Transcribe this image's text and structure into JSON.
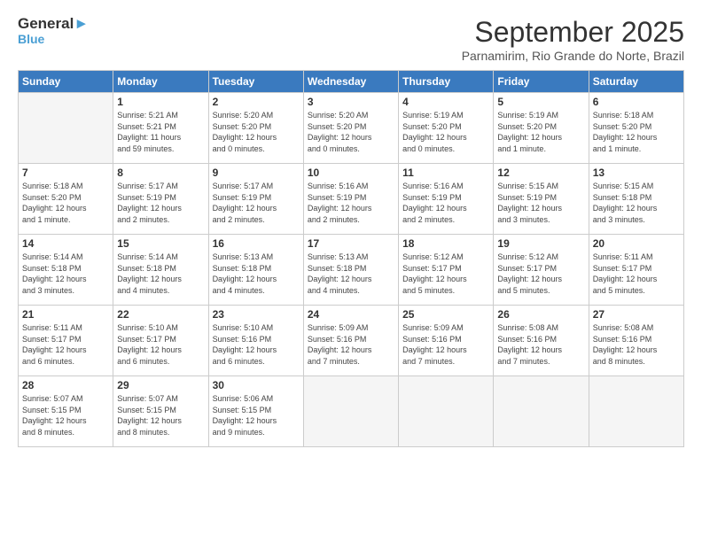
{
  "header": {
    "logo_line1": "General",
    "logo_line2": "Blue",
    "month_title": "September 2025",
    "subtitle": "Parnamirim, Rio Grande do Norte, Brazil"
  },
  "days_of_week": [
    "Sunday",
    "Monday",
    "Tuesday",
    "Wednesday",
    "Thursday",
    "Friday",
    "Saturday"
  ],
  "weeks": [
    [
      {
        "num": "",
        "info": ""
      },
      {
        "num": "1",
        "info": "Sunrise: 5:21 AM\nSunset: 5:21 PM\nDaylight: 11 hours\nand 59 minutes."
      },
      {
        "num": "2",
        "info": "Sunrise: 5:20 AM\nSunset: 5:20 PM\nDaylight: 12 hours\nand 0 minutes."
      },
      {
        "num": "3",
        "info": "Sunrise: 5:20 AM\nSunset: 5:20 PM\nDaylight: 12 hours\nand 0 minutes."
      },
      {
        "num": "4",
        "info": "Sunrise: 5:19 AM\nSunset: 5:20 PM\nDaylight: 12 hours\nand 0 minutes."
      },
      {
        "num": "5",
        "info": "Sunrise: 5:19 AM\nSunset: 5:20 PM\nDaylight: 12 hours\nand 1 minute."
      },
      {
        "num": "6",
        "info": "Sunrise: 5:18 AM\nSunset: 5:20 PM\nDaylight: 12 hours\nand 1 minute."
      }
    ],
    [
      {
        "num": "7",
        "info": "Sunrise: 5:18 AM\nSunset: 5:20 PM\nDaylight: 12 hours\nand 1 minute."
      },
      {
        "num": "8",
        "info": "Sunrise: 5:17 AM\nSunset: 5:19 PM\nDaylight: 12 hours\nand 2 minutes."
      },
      {
        "num": "9",
        "info": "Sunrise: 5:17 AM\nSunset: 5:19 PM\nDaylight: 12 hours\nand 2 minutes."
      },
      {
        "num": "10",
        "info": "Sunrise: 5:16 AM\nSunset: 5:19 PM\nDaylight: 12 hours\nand 2 minutes."
      },
      {
        "num": "11",
        "info": "Sunrise: 5:16 AM\nSunset: 5:19 PM\nDaylight: 12 hours\nand 2 minutes."
      },
      {
        "num": "12",
        "info": "Sunrise: 5:15 AM\nSunset: 5:19 PM\nDaylight: 12 hours\nand 3 minutes."
      },
      {
        "num": "13",
        "info": "Sunrise: 5:15 AM\nSunset: 5:18 PM\nDaylight: 12 hours\nand 3 minutes."
      }
    ],
    [
      {
        "num": "14",
        "info": "Sunrise: 5:14 AM\nSunset: 5:18 PM\nDaylight: 12 hours\nand 3 minutes."
      },
      {
        "num": "15",
        "info": "Sunrise: 5:14 AM\nSunset: 5:18 PM\nDaylight: 12 hours\nand 4 minutes."
      },
      {
        "num": "16",
        "info": "Sunrise: 5:13 AM\nSunset: 5:18 PM\nDaylight: 12 hours\nand 4 minutes."
      },
      {
        "num": "17",
        "info": "Sunrise: 5:13 AM\nSunset: 5:18 PM\nDaylight: 12 hours\nand 4 minutes."
      },
      {
        "num": "18",
        "info": "Sunrise: 5:12 AM\nSunset: 5:17 PM\nDaylight: 12 hours\nand 5 minutes."
      },
      {
        "num": "19",
        "info": "Sunrise: 5:12 AM\nSunset: 5:17 PM\nDaylight: 12 hours\nand 5 minutes."
      },
      {
        "num": "20",
        "info": "Sunrise: 5:11 AM\nSunset: 5:17 PM\nDaylight: 12 hours\nand 5 minutes."
      }
    ],
    [
      {
        "num": "21",
        "info": "Sunrise: 5:11 AM\nSunset: 5:17 PM\nDaylight: 12 hours\nand 6 minutes."
      },
      {
        "num": "22",
        "info": "Sunrise: 5:10 AM\nSunset: 5:17 PM\nDaylight: 12 hours\nand 6 minutes."
      },
      {
        "num": "23",
        "info": "Sunrise: 5:10 AM\nSunset: 5:16 PM\nDaylight: 12 hours\nand 6 minutes."
      },
      {
        "num": "24",
        "info": "Sunrise: 5:09 AM\nSunset: 5:16 PM\nDaylight: 12 hours\nand 7 minutes."
      },
      {
        "num": "25",
        "info": "Sunrise: 5:09 AM\nSunset: 5:16 PM\nDaylight: 12 hours\nand 7 minutes."
      },
      {
        "num": "26",
        "info": "Sunrise: 5:08 AM\nSunset: 5:16 PM\nDaylight: 12 hours\nand 7 minutes."
      },
      {
        "num": "27",
        "info": "Sunrise: 5:08 AM\nSunset: 5:16 PM\nDaylight: 12 hours\nand 8 minutes."
      }
    ],
    [
      {
        "num": "28",
        "info": "Sunrise: 5:07 AM\nSunset: 5:15 PM\nDaylight: 12 hours\nand 8 minutes."
      },
      {
        "num": "29",
        "info": "Sunrise: 5:07 AM\nSunset: 5:15 PM\nDaylight: 12 hours\nand 8 minutes."
      },
      {
        "num": "30",
        "info": "Sunrise: 5:06 AM\nSunset: 5:15 PM\nDaylight: 12 hours\nand 9 minutes."
      },
      {
        "num": "",
        "info": ""
      },
      {
        "num": "",
        "info": ""
      },
      {
        "num": "",
        "info": ""
      },
      {
        "num": "",
        "info": ""
      }
    ]
  ]
}
